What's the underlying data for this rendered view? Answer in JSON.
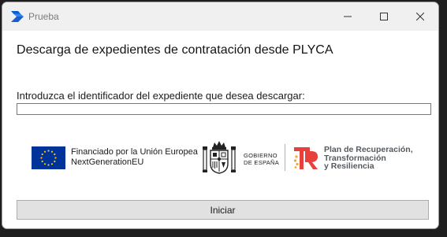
{
  "window": {
    "title": "Prueba",
    "icon": "power-automate-icon",
    "controls": [
      "minimize-icon",
      "maximize-icon",
      "close-icon"
    ]
  },
  "main": {
    "heading": "Descarga de expedientes de contratación desde PLYCA",
    "prompt": "Introduzca el identificador del expediente que desea descargar:",
    "input_value": "",
    "start_button_label": "Iniciar"
  },
  "logos": {
    "eu_line1": "Financiado por la Unión Europea",
    "eu_line2": "NextGenerationEU",
    "gov_line1": "GOBIERNO",
    "gov_line2": "DE ESPAÑA",
    "prtr_line1": "Plan de Recuperación,",
    "prtr_line2": "Transformación",
    "prtr_line3": "y Resiliencia"
  },
  "colors": {
    "eu_blue": "#003399",
    "eu_star": "#ffcc00",
    "prtr_red": "#e8403a",
    "prtr_orange": "#f5a623",
    "app_icon_blue": "#1e6fd9",
    "button_bg": "#e1e1e1"
  }
}
